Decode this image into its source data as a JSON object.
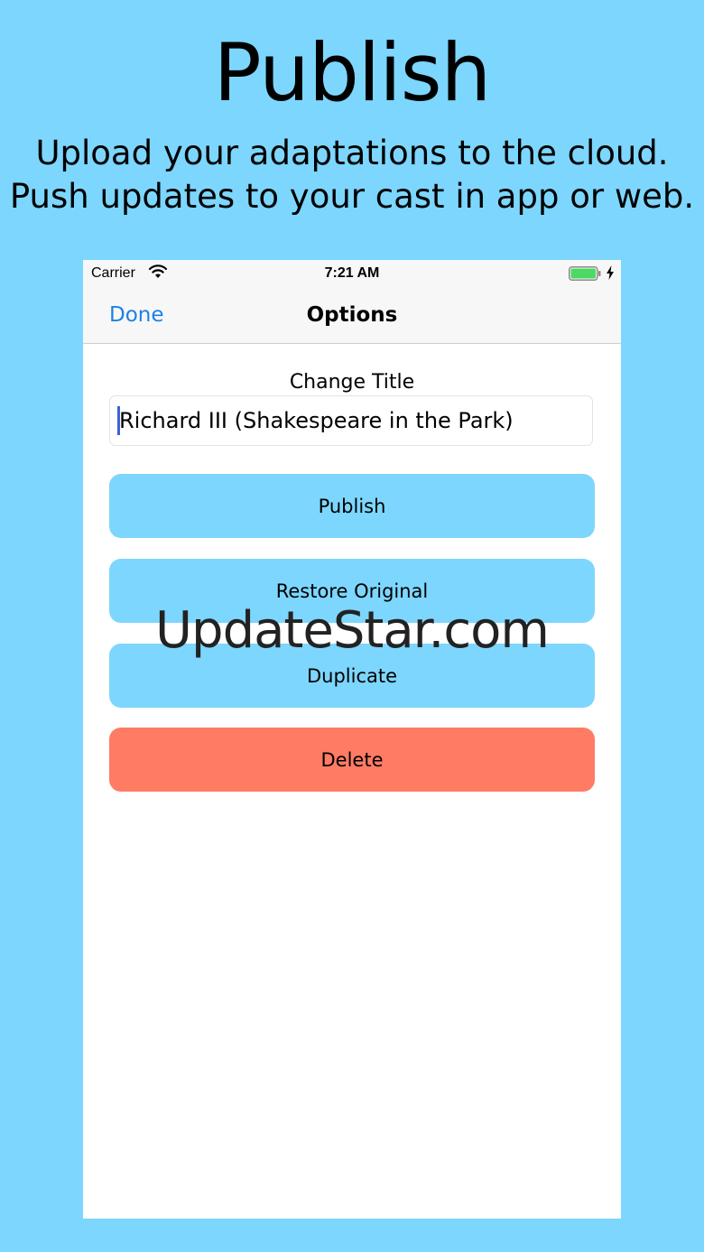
{
  "promo": {
    "headline": "Publish",
    "subline_1": "Upload your adaptations to the cloud.",
    "subline_2": "Push updates to your cast in app or web."
  },
  "status_bar": {
    "carrier": "Carrier",
    "time": "7:21 AM",
    "battery_color": "#4cd964",
    "icons": [
      "wifi-icon",
      "battery-icon",
      "charging-icon"
    ]
  },
  "nav": {
    "done_label": "Done",
    "title": "Options",
    "done_color": "#1a82e6"
  },
  "form": {
    "field_label": "Change Title",
    "title_value": "Richard III (Shakespeare in the Park)"
  },
  "actions": {
    "publish_label": "Publish",
    "restore_label": "Restore Original",
    "duplicate_label": "Duplicate",
    "delete_label": "Delete",
    "button_color": "#7dd6fd",
    "delete_color": "#ff7b64"
  },
  "watermark": {
    "text": "UpdateStar.com"
  }
}
